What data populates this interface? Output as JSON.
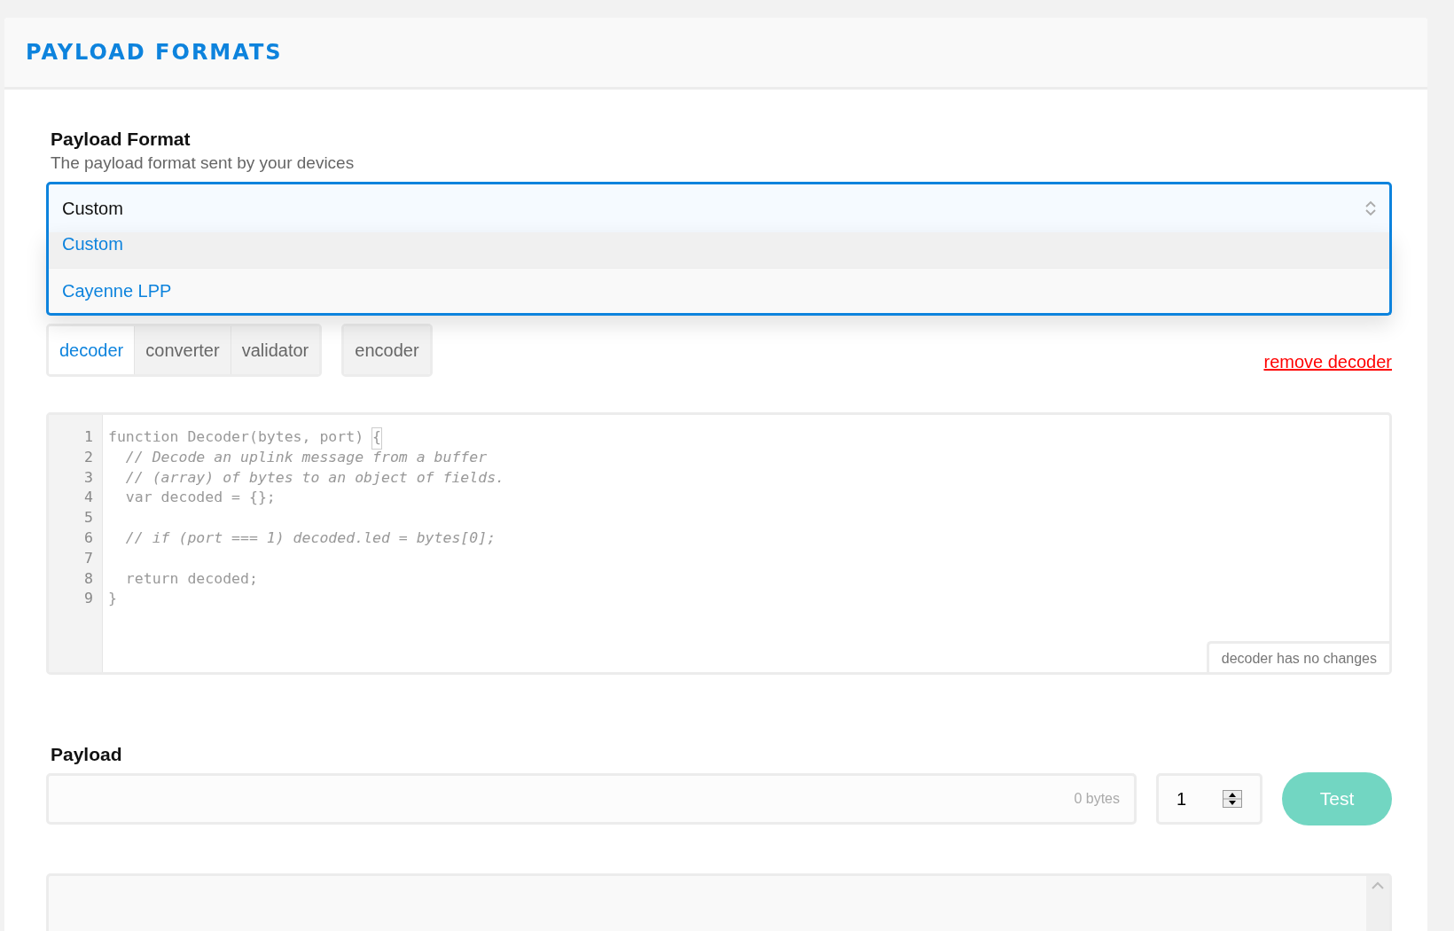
{
  "section_title": "PAYLOAD FORMATS",
  "format_field": {
    "label": "Payload Format",
    "description": "The payload format sent by your devices",
    "value": "Custom",
    "expanded": true,
    "options": [
      {
        "label": "Custom",
        "selected": true
      },
      {
        "label": "Cayenne LPP",
        "selected": false
      }
    ]
  },
  "function_tabs": [
    [
      {
        "label": "decoder",
        "selected": true
      },
      {
        "label": "converter",
        "selected": false
      },
      {
        "label": "validator",
        "selected": false
      }
    ],
    [
      {
        "label": "encoder",
        "selected": false
      }
    ]
  ],
  "remove_link": "remove decoder",
  "editor": {
    "lines": [
      {
        "number": "1",
        "segments": [
          {
            "text": "function Decoder(bytes, port) ",
            "kind": "code"
          },
          {
            "text": "{",
            "kind": "bracket"
          }
        ]
      },
      {
        "number": "2",
        "segments": [
          {
            "text": "  // Decode an uplink message from a buffer",
            "kind": "comment"
          }
        ]
      },
      {
        "number": "3",
        "segments": [
          {
            "text": "  // (array) of bytes to an object of fields.",
            "kind": "comment"
          }
        ]
      },
      {
        "number": "4",
        "segments": [
          {
            "text": "  var decoded = {};",
            "kind": "code"
          }
        ]
      },
      {
        "number": "5"
      },
      {
        "number": "6",
        "segments": [
          {
            "text": "  // if (port === 1) decoded.led = bytes[0];",
            "kind": "comment"
          }
        ]
      },
      {
        "number": "7"
      },
      {
        "number": "8",
        "segments": [
          {
            "text": "  return decoded;",
            "kind": "code"
          }
        ]
      },
      {
        "number": "9",
        "segments": [
          {
            "text": "}",
            "kind": "code"
          }
        ]
      }
    ],
    "status": "decoder has no changes"
  },
  "payload": {
    "label": "Payload",
    "byte_count": "0 bytes",
    "port": "1",
    "test_button": "Test"
  }
}
